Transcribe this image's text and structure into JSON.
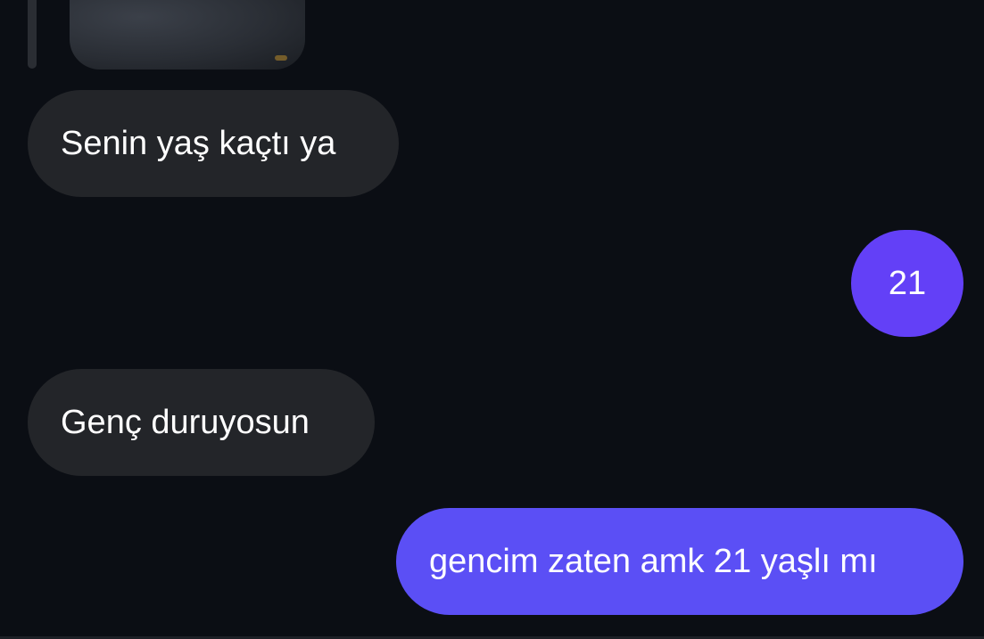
{
  "messages": [
    {
      "direction": "incoming",
      "text": "Senin yaş kaçtı ya"
    },
    {
      "direction": "outgoing",
      "text": "21"
    },
    {
      "direction": "incoming",
      "text": "Genç duruyosun"
    },
    {
      "direction": "outgoing",
      "text": "gencim zaten amk 21 yaşlı mı"
    }
  ],
  "colors": {
    "background": "#0b0e14",
    "incoming_bubble": "#232529",
    "outgoing_bubble": "#5b4ff5"
  }
}
